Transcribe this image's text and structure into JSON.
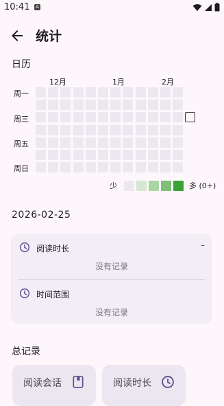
{
  "status_bar": {
    "time": "10:41",
    "notification_icon": "a-badge-icon"
  },
  "header": {
    "title": "统计",
    "back_icon": "arrow-back-icon"
  },
  "calendar": {
    "title": "日历",
    "months": [
      "12月",
      "1月",
      "2月"
    ],
    "weekdays": [
      "周一",
      "周三",
      "周五",
      "周日"
    ],
    "legend": {
      "less": "少",
      "more": "多 (0+)",
      "colors": [
        "#ece8ef",
        "#d4e8d1",
        "#a9d5a2",
        "#7fbf76",
        "#3aa335"
      ]
    },
    "cell_color": "#ece8ef",
    "today_outline": true
  },
  "day": {
    "date": "2026-02-25",
    "reading_time": {
      "label": "阅读时长",
      "value": "–",
      "empty": "没有记录"
    },
    "time_range": {
      "label": "时间范围",
      "empty": "没有记录"
    }
  },
  "totals": {
    "title": "总记录",
    "cards": [
      {
        "label": "阅读会话",
        "icon": "book-icon"
      },
      {
        "label": "阅读时长",
        "icon": "clock-icon"
      }
    ]
  },
  "colors": {
    "accent": "#5d4d91",
    "background": "#fdf7fc",
    "card": "#f3eef5"
  }
}
